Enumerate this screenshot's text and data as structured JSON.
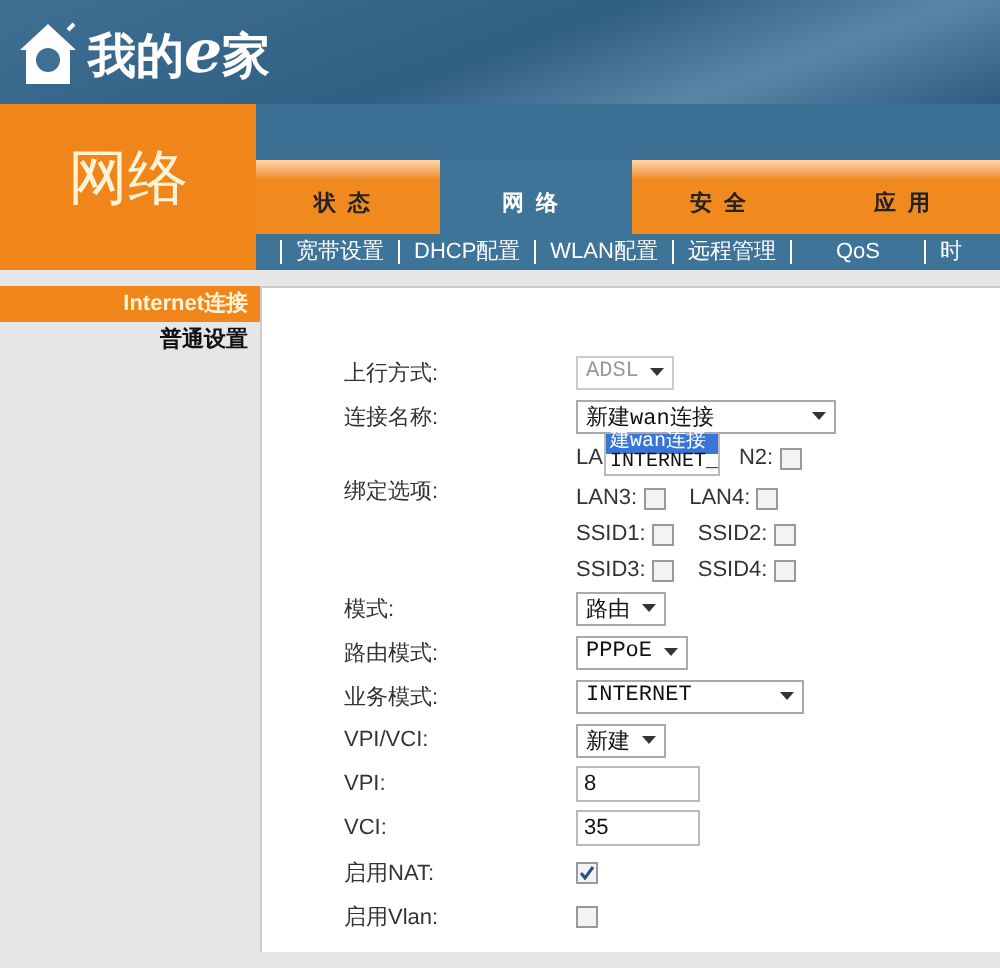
{
  "logo": {
    "parts": [
      "我的",
      "e",
      "家"
    ]
  },
  "section_title": "网络",
  "tabs": [
    {
      "label": "状态",
      "selected": false
    },
    {
      "label": "网络",
      "selected": true
    },
    {
      "label": "安全",
      "selected": false
    },
    {
      "label": "应用",
      "selected": false
    }
  ],
  "subnav": [
    "宽带设置",
    "DHCP配置",
    "WLAN配置",
    "远程管理",
    "QoS",
    "时"
  ],
  "sidebar": {
    "items": [
      {
        "label": "Internet连接",
        "selected": true
      },
      {
        "label": "普通设置",
        "selected": false
      }
    ]
  },
  "form": {
    "rows": [
      {
        "kind": "select",
        "label": "上行方式:",
        "value": "ADSL",
        "disabled": true
      },
      {
        "kind": "select",
        "label": "连接名称:",
        "value": "新建wan连接",
        "disabled": false,
        "expanded": true,
        "options": [
          {
            "label": "建wan连接",
            "selected": true
          },
          {
            "label": "INTERNET_",
            "selected": false
          }
        ]
      },
      {
        "kind": "bind",
        "label": "绑定选项:",
        "lines": [
          [
            {
              "label": "LA"
            },
            {
              "label": "N2:",
              "checked": false
            }
          ],
          [
            {
              "label": "LAN3:",
              "checked": false
            },
            {
              "label": "LAN4:",
              "checked": false
            }
          ],
          [
            {
              "label": "SSID1:",
              "checked": false
            },
            {
              "label": "SSID2:",
              "checked": false
            }
          ],
          [
            {
              "label": "SSID3:",
              "checked": false
            },
            {
              "label": "SSID4:",
              "checked": false
            }
          ]
        ]
      },
      {
        "kind": "select",
        "label": "模式:",
        "value": "路由",
        "disabled": false
      },
      {
        "kind": "select",
        "label": "路由模式:",
        "value": "PPPoE",
        "disabled": false
      },
      {
        "kind": "select",
        "label": "业务模式:",
        "value": "INTERNET",
        "disabled": false
      },
      {
        "kind": "select",
        "label": "VPI/VCI:",
        "value": "新建",
        "disabled": false
      },
      {
        "kind": "text",
        "label": "VPI:",
        "value": "8"
      },
      {
        "kind": "text",
        "label": "VCI:",
        "value": "35"
      },
      {
        "kind": "checkbox",
        "label": "启用NAT:",
        "checked": true
      },
      {
        "kind": "checkbox",
        "label": "启用Vlan:",
        "checked": false
      }
    ]
  }
}
